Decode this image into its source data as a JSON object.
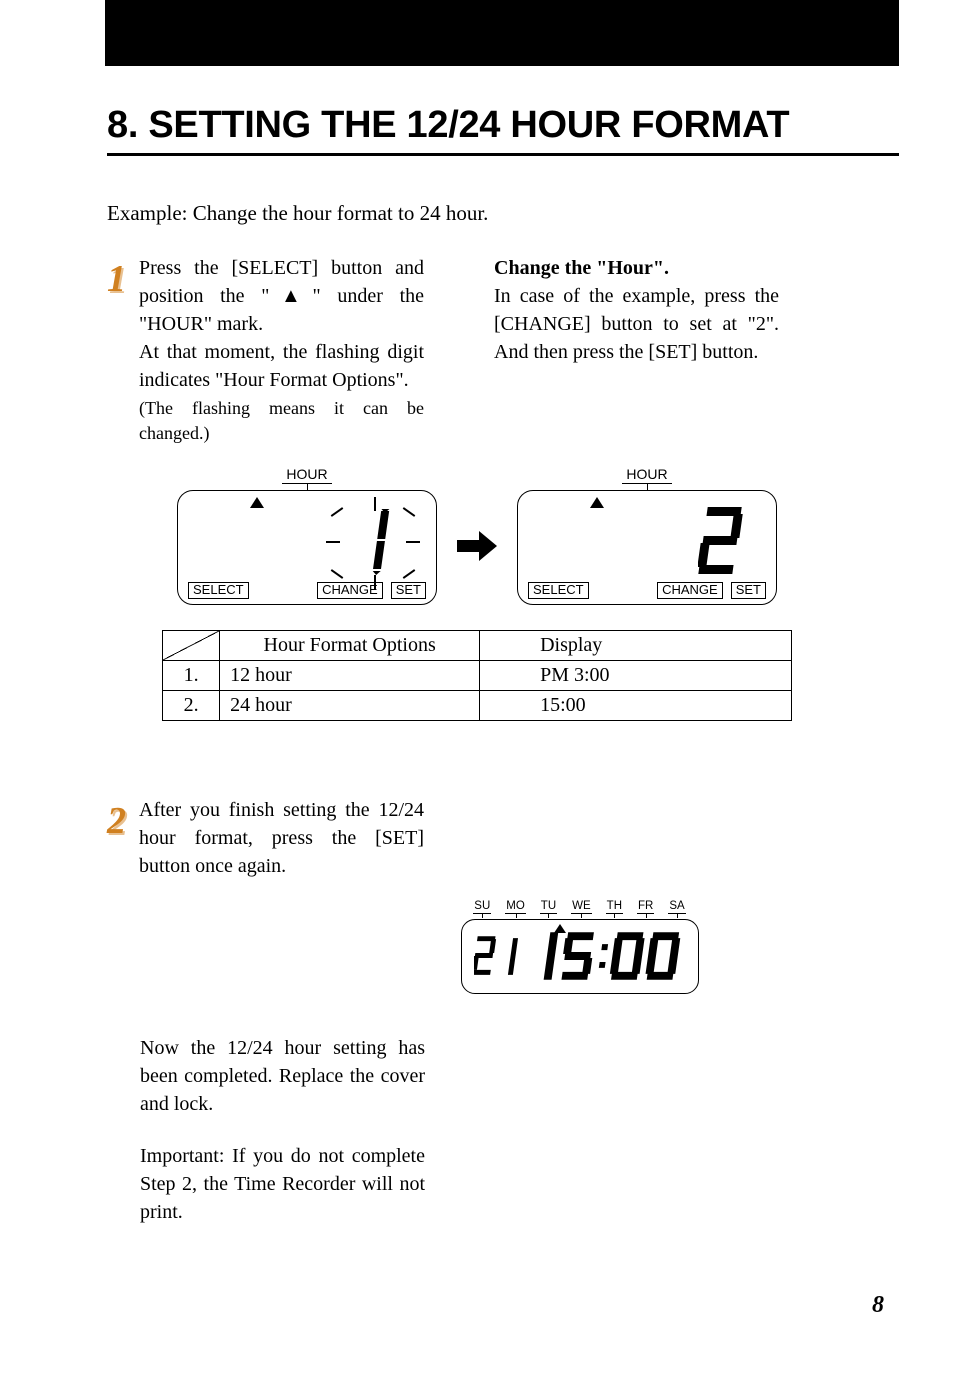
{
  "title": "8. SETTING THE 12/24 HOUR FORMAT",
  "example": "Example: Change the hour format to 24 hour.",
  "step1": {
    "num": "1",
    "left_p1": "Press the [SELECT] button and position the \"▲\" under the \"HOUR\" mark.",
    "left_p2": "At that moment, the flashing digit indicates \"Hour Format Options\".",
    "left_note": "(The flashing means it can be changed.)",
    "right_heading": "Change the \"Hour\".",
    "right_p": "In case of the example, press the [CHANGE] button to set at \"2\". And then press the [SET] button."
  },
  "panels": {
    "hour_label": "HOUR",
    "buttons": {
      "select": "SELECT",
      "change": "CHANGE",
      "set": "SET"
    },
    "left_digit": "1",
    "right_digit": "2"
  },
  "table": {
    "h_opts": "Hour Format Options",
    "h_disp": "Display",
    "rows": [
      {
        "idx": "1.",
        "opt": "12 hour",
        "disp": "PM 3:00"
      },
      {
        "idx": "2.",
        "opt": "24 hour",
        "disp": "15:00"
      }
    ]
  },
  "step2": {
    "num": "2",
    "text": "After you finish setting the 12/24 hour format, press the [SET] button once again."
  },
  "days": [
    "SU",
    "MO",
    "TU",
    "WE",
    "TH",
    "FR",
    "SA"
  ],
  "final_display": {
    "date": "21",
    "time": "15:00"
  },
  "after": {
    "p1": "Now the 12/24 hour setting has been completed. Replace the cover and lock.",
    "p2": "Important: If you do not complete Step 2, the Time Recorder will  not print."
  },
  "page_number": "8"
}
